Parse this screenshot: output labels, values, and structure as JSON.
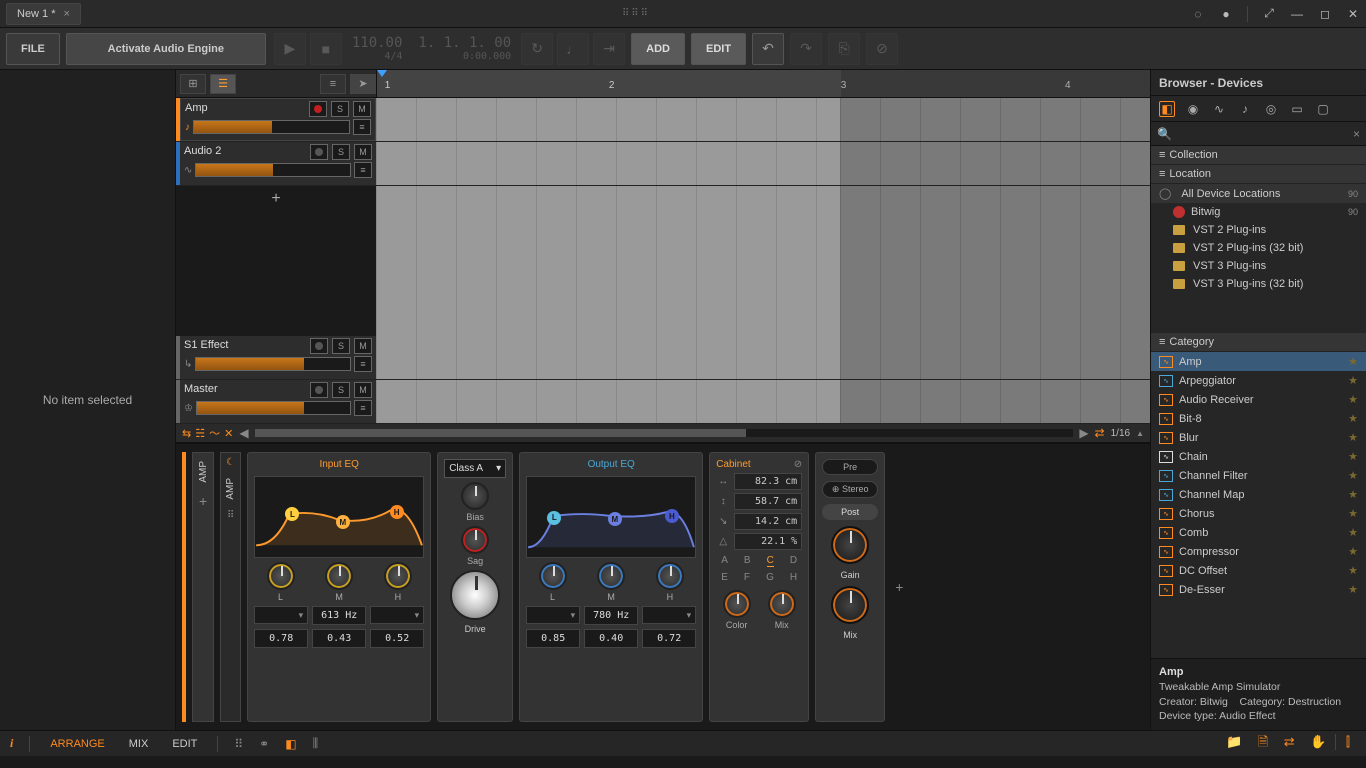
{
  "title_tab": "New 1 *",
  "toolbar": {
    "file": "FILE",
    "activate": "Activate Audio Engine",
    "tempo": "110.00",
    "sig": "4/4",
    "position": "1. 1. 1. 00",
    "time": "0:00.000",
    "add": "ADD",
    "edit": "EDIT"
  },
  "leftpanel": {
    "empty": "No item selected"
  },
  "ruler": {
    "marks": [
      "1",
      "2",
      "3",
      "4"
    ]
  },
  "tracks": [
    {
      "name": "Amp",
      "color": "orange",
      "armed": true,
      "vol": 50
    },
    {
      "name": "Audio 2",
      "color": "blue",
      "armed": false,
      "vol": 50
    }
  ],
  "aux_tracks": [
    {
      "name": "S1 Effect",
      "color": "grey",
      "vol": 70
    },
    {
      "name": "Master",
      "color": "grey",
      "vol": 70
    }
  ],
  "zoom": "1/16",
  "device": {
    "name": "AMP",
    "input_eq": {
      "title": "Input EQ",
      "bands": [
        "L",
        "M",
        "H"
      ],
      "freq": "613 Hz",
      "vals": [
        "0.78",
        "0.43",
        "0.52"
      ]
    },
    "amp_class": {
      "selected": "Class A",
      "knobs": [
        "Bias",
        "Sag",
        "Drive"
      ]
    },
    "output_eq": {
      "title": "Output EQ",
      "bands": [
        "L",
        "M",
        "H"
      ],
      "freq": "780 Hz",
      "vals": [
        "0.85",
        "0.40",
        "0.72"
      ]
    },
    "cabinet": {
      "title": "Cabinet",
      "width": "82.3 cm",
      "height": "58.7 cm",
      "depth": "14.2 cm",
      "ratio": "22.1 %",
      "row1": [
        "A",
        "B",
        "C",
        "D"
      ],
      "row1_sel": "C",
      "row2": [
        "E",
        "F",
        "G",
        "H"
      ],
      "knobs": [
        "Color",
        "Mix"
      ]
    },
    "post": {
      "pre": "Pre",
      "stereo": "Stereo",
      "post": "Post",
      "gain": "Gain",
      "mix": "Mix"
    }
  },
  "browser": {
    "title": "Browser - Devices",
    "search_ph": "",
    "collection": "Collection",
    "location": "Location",
    "all_locations": "All Device Locations",
    "all_count": "90",
    "locations": [
      {
        "label": "Bitwig",
        "count": "90",
        "type": "bitwig"
      },
      {
        "label": "VST 2 Plug-ins",
        "type": "loc"
      },
      {
        "label": "VST 2 Plug-ins (32 bit)",
        "type": "loc"
      },
      {
        "label": "VST 3 Plug-ins",
        "type": "loc"
      },
      {
        "label": "VST 3 Plug-ins (32 bit)",
        "type": "loc"
      }
    ],
    "category": "Category",
    "categories": [
      {
        "label": "Amp",
        "color": "#ff8a1f",
        "sel": true
      },
      {
        "label": "Arpeggiator",
        "color": "#4aa8d8"
      },
      {
        "label": "Audio Receiver",
        "color": "#ff8a1f"
      },
      {
        "label": "Bit-8",
        "color": "#ff8a1f"
      },
      {
        "label": "Blur",
        "color": "#ff8a1f"
      },
      {
        "label": "Chain",
        "color": "#ddd"
      },
      {
        "label": "Channel Filter",
        "color": "#4aa8d8"
      },
      {
        "label": "Channel Map",
        "color": "#4aa8d8"
      },
      {
        "label": "Chorus",
        "color": "#ff8a1f"
      },
      {
        "label": "Comb",
        "color": "#ff8a1f"
      },
      {
        "label": "Compressor",
        "color": "#ff8a1f"
      },
      {
        "label": "DC Offset",
        "color": "#ff8a1f"
      },
      {
        "label": "De-Esser",
        "color": "#ff8a1f"
      }
    ],
    "info": {
      "name": "Amp",
      "desc": "Tweakable Amp Simulator",
      "creator_lbl": "Creator:",
      "creator": "Bitwig",
      "category_lbl": "Category:",
      "category": "Destruction",
      "type_lbl": "Device type:",
      "type": "Audio Effect"
    }
  },
  "status": {
    "arrange": "ARRANGE",
    "mix": "MIX",
    "edit": "EDIT"
  }
}
